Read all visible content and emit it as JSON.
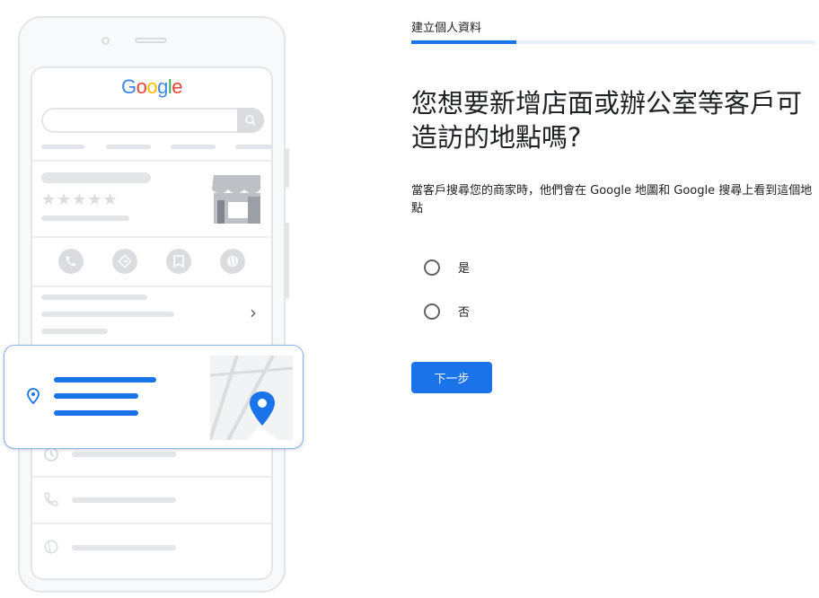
{
  "illustration": {
    "logo": [
      "G",
      "o",
      "o",
      "g",
      "l",
      "e"
    ],
    "logo_colors": [
      "#4285f4",
      "#ea4335",
      "#fbbc05",
      "#4285f4",
      "#34a853",
      "#ea4335"
    ],
    "stars": "★★★★★",
    "chevron": "›"
  },
  "form": {
    "step_label": "建立個人資料",
    "progress_fraction": 0.26,
    "heading": "您想要新增店面或辦公室等客戶可造訪的地點嗎?",
    "description": "當客戶搜尋您的商家時，他們會在 Google 地圖和 Google 搜尋上看到這個地點",
    "options": [
      {
        "label": "是",
        "selected": false
      },
      {
        "label": "否",
        "selected": false
      }
    ],
    "next_button": "下一步"
  },
  "colors": {
    "accent": "#1a73e8",
    "map_pin": "#1a73e8"
  }
}
